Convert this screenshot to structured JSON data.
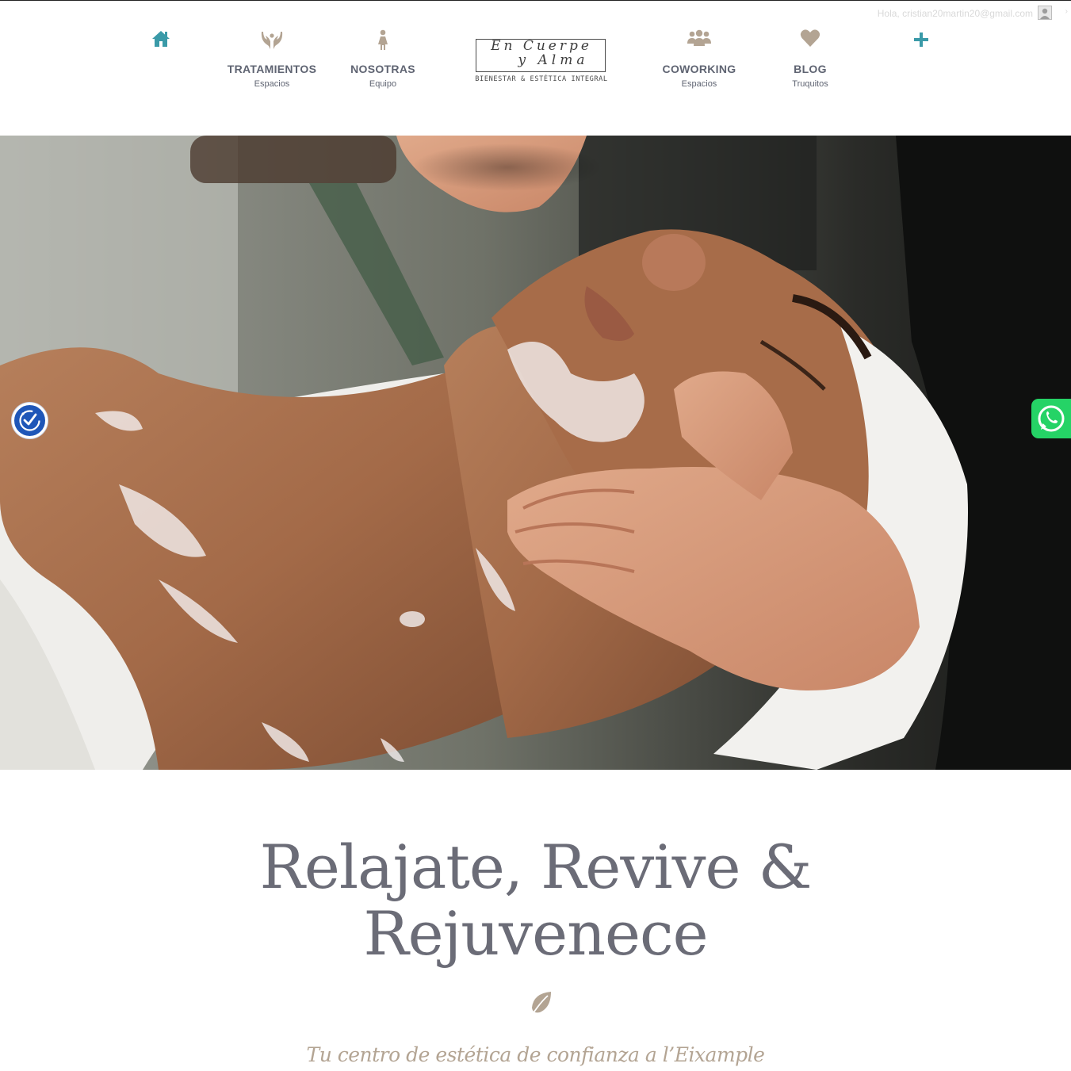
{
  "user": {
    "greeting": "Hola, cristian20martin20@gmail.com"
  },
  "nav": {
    "home_icon": "home-icon",
    "items_left": [
      {
        "label": "TRATAMIENTOS",
        "sub": "Espacios",
        "icon": "hands-icon"
      },
      {
        "label": "NOSOTRAS",
        "sub": "Equipo",
        "icon": "woman-icon"
      }
    ],
    "items_right": [
      {
        "label": "COWORKING",
        "sub": "Espacios",
        "icon": "group-icon"
      },
      {
        "label": "BLOG",
        "sub": "Truquitos",
        "icon": "heart-icon"
      }
    ],
    "plus_icon": "plus-icon"
  },
  "logo": {
    "line1": "En Cuerpe",
    "line2": "y Alma",
    "tagline": "BIENESTAR & ESTÉTICA INTEGRAL"
  },
  "hero": {
    "image": "facial-massage-photo"
  },
  "floating": {
    "accessibility_icon": "accessibility-icon",
    "whatsapp_icon": "whatsapp-icon"
  },
  "content": {
    "headline_line1": "Relajate, Revive &",
    "headline_line2": "Rejuvenece",
    "divider_icon": "leaf-icon",
    "tagline": "Tu centro de estética de confianza a l’Eixample"
  },
  "colors": {
    "accent_teal": "#3a9aa8",
    "icon_taupe": "#b3a493",
    "nav_text": "#5f6472",
    "headline": "#6b6c77",
    "whatsapp": "#25d366",
    "accessibility": "#1e56b8"
  }
}
